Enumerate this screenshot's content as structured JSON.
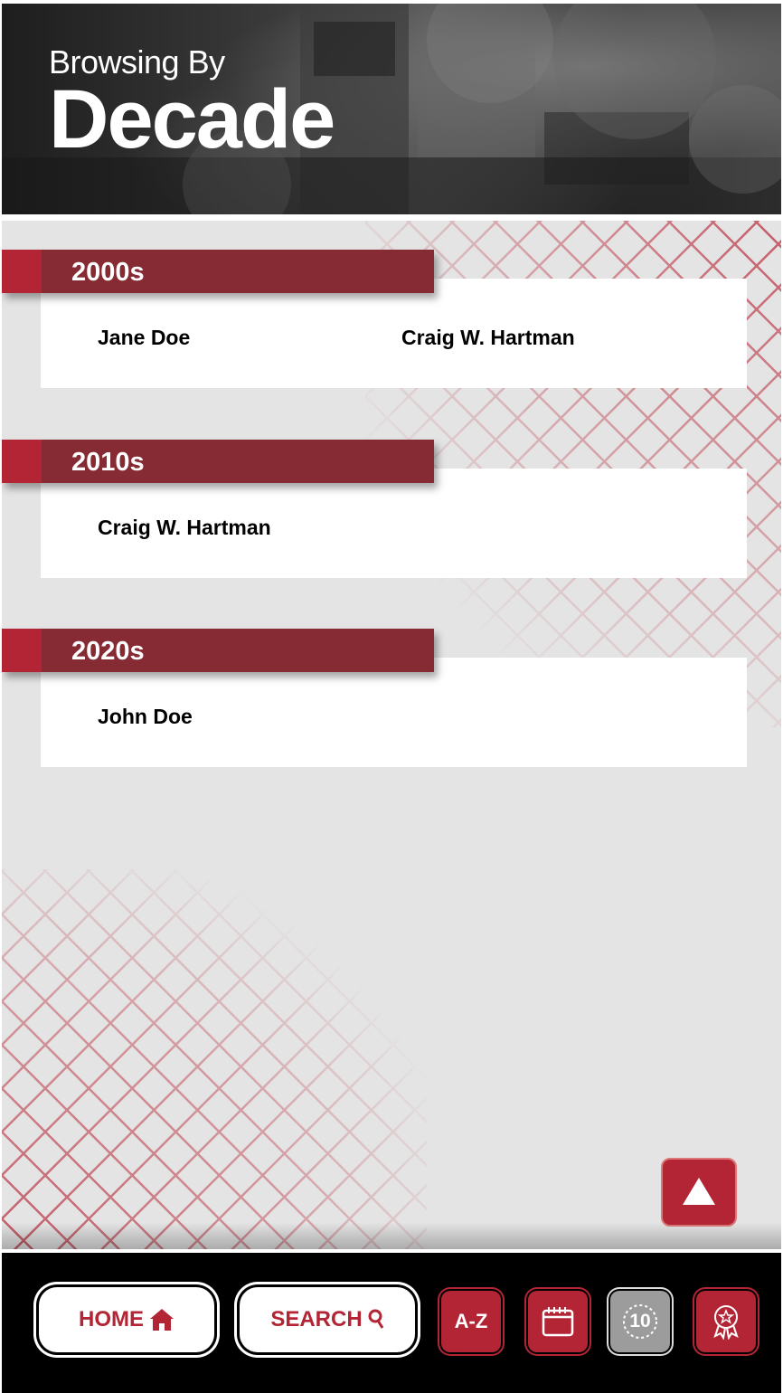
{
  "header": {
    "subtitle": "Browsing By",
    "title": "Decade"
  },
  "decades": [
    {
      "label": "2000s",
      "names": [
        "Jane Doe",
        "Craig W. Hartman"
      ]
    },
    {
      "label": "2010s",
      "names": [
        "Craig W. Hartman"
      ]
    },
    {
      "label": "2020s",
      "names": [
        "John Doe"
      ]
    }
  ],
  "scroll_top": {
    "icon": "triangle-up-icon"
  },
  "nav": {
    "home_label": "HOME",
    "home_icon": "house-icon",
    "search_label": "SEARCH",
    "search_icon": "magnifier-icon",
    "az_label": "A-Z",
    "calendar_icon": "calendar-icon",
    "ten_label": "10",
    "award_icon": "award-ribbon-icon"
  },
  "colors": {
    "brand_red": "#b32535",
    "band_red": "#862a33",
    "background": "#e4e4e4"
  }
}
